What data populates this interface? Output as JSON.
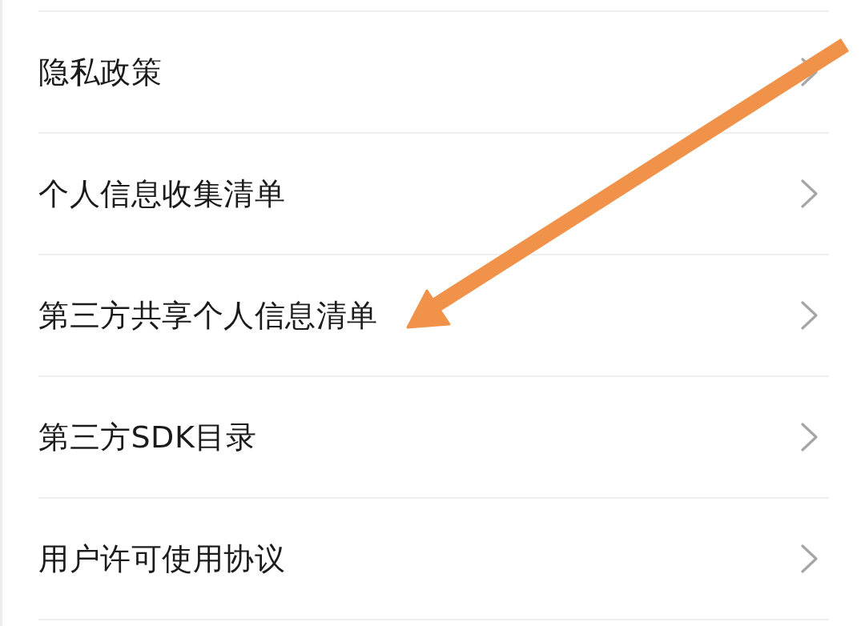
{
  "rows": [
    {
      "label": "隐私政策"
    },
    {
      "label": "个人信息收集清单"
    },
    {
      "label": "第三方共享个人信息清单"
    },
    {
      "label": "第三方SDK目录"
    },
    {
      "label": "用户许可使用协议"
    }
  ]
}
